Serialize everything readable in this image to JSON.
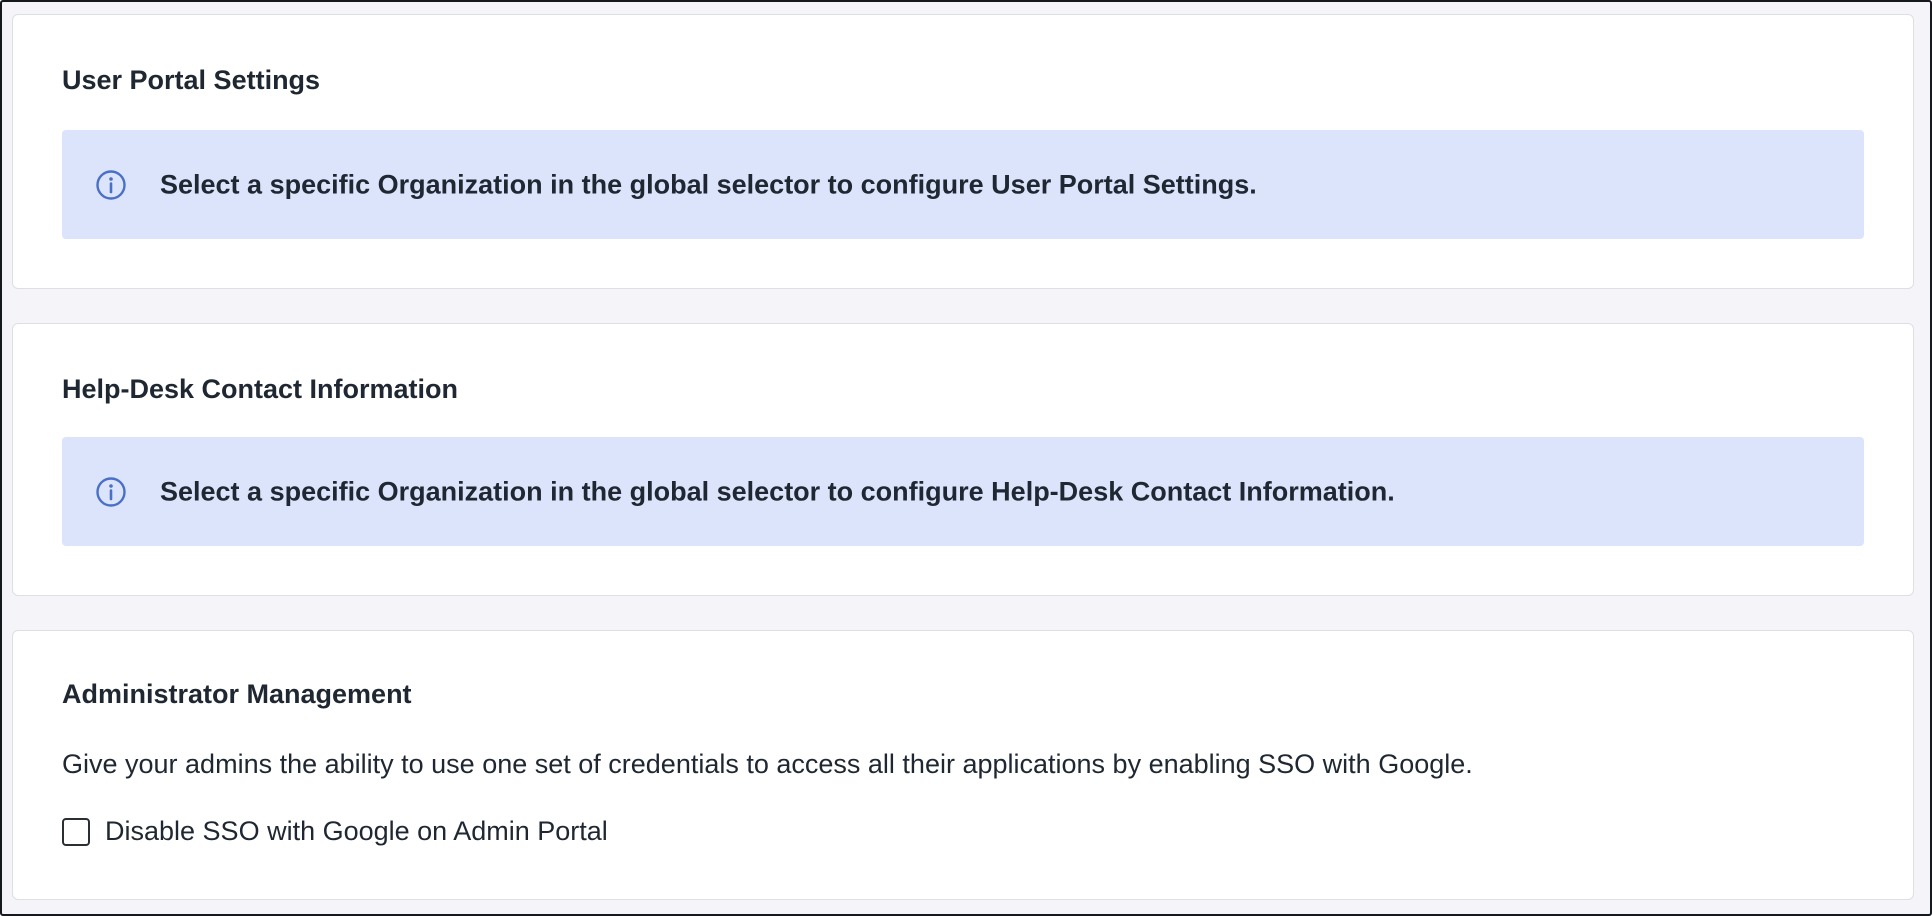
{
  "sections": {
    "user_portal": {
      "title": "User Portal Settings",
      "banner": {
        "icon": "info-icon",
        "text": "Select a specific Organization in the global selector to configure User Portal Settings."
      }
    },
    "help_desk": {
      "title": "Help-Desk Contact Information",
      "banner": {
        "icon": "info-icon",
        "text": "Select a specific Organization in the global selector to configure Help-Desk Contact Information."
      }
    },
    "admin_management": {
      "title": "Administrator Management",
      "description": "Give your admins the ability to use one set of credentials to access all their applications by enabling SSO with Google.",
      "checkbox": {
        "label": "Disable SSO with Google on Admin Portal",
        "checked": false
      }
    }
  },
  "colors": {
    "page_background": "#f5f5f9",
    "card_background": "#ffffff",
    "banner_background": "#dbe4fb",
    "info_icon": "#4a6fc7",
    "text": "#1f2732"
  }
}
